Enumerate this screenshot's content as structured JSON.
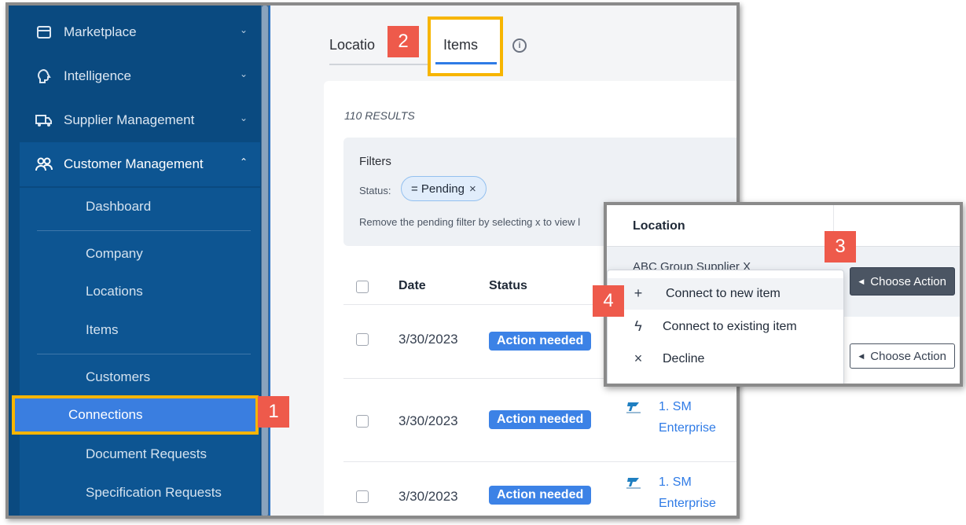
{
  "sidebar": {
    "groups": [
      {
        "label": "Marketplace",
        "icon": "store-icon"
      },
      {
        "label": "Intelligence",
        "icon": "brain-icon"
      },
      {
        "label": "Supplier Management",
        "icon": "truck-icon"
      },
      {
        "label": "Customer Management",
        "icon": "users-icon"
      }
    ],
    "subitems": [
      "Dashboard",
      "Company",
      "Locations",
      "Items",
      "Customers",
      "Connections",
      "Document Requests",
      "Specification Requests"
    ]
  },
  "tabs": {
    "locations": "Locatio",
    "items": "Items"
  },
  "results_count": "110 RESULTS",
  "filters": {
    "title": "Filters",
    "status_label": "Status:",
    "chip_label": "= Pending",
    "chip_close": "×",
    "hint": "Remove the pending filter by selecting x to view l"
  },
  "table": {
    "headers": {
      "date": "Date",
      "status": "Status"
    },
    "rows": [
      {
        "date": "3/30/2023",
        "status": "Action needed",
        "link1": "",
        "link2": ""
      },
      {
        "date": "3/30/2023",
        "status": "Action needed",
        "link1": "1. SM",
        "link2": "Enterprise"
      },
      {
        "date": "3/30/2023",
        "status": "Action needed",
        "link1": "1. SM",
        "link2": "Enterprise"
      }
    ]
  },
  "popup": {
    "column_header": "Location",
    "peek_text": "ABC Group    Supplier X",
    "menu": [
      {
        "icon": "plus-icon",
        "glyph": "+",
        "label": "Connect to new item"
      },
      {
        "icon": "bolt-icon",
        "glyph": "ϟ",
        "label": "Connect to existing item"
      },
      {
        "icon": "close-icon",
        "glyph": "×",
        "label": "Decline"
      }
    ],
    "choose_action": "Choose Action"
  },
  "callouts": [
    "1",
    "2",
    "3",
    "4"
  ],
  "colors": {
    "sidebar": "#0a4a80",
    "submenu": "#0d5592",
    "accent": "#2f7be6",
    "highlight": "#f7b500",
    "callout": "#ee5a4b",
    "badge": "#3c82e6"
  }
}
